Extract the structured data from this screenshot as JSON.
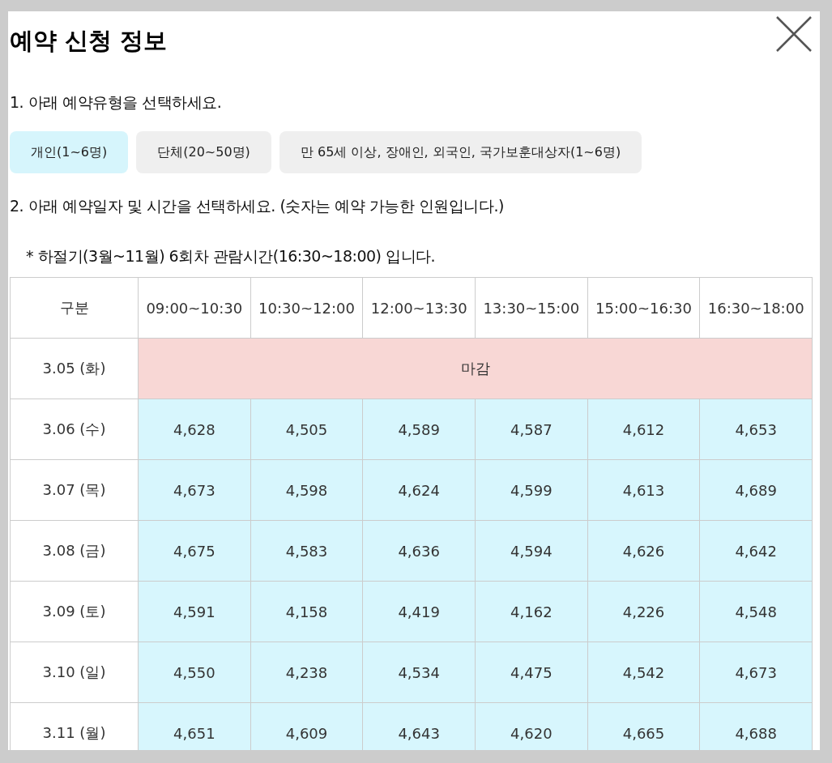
{
  "title": "예약 신청 정보",
  "step1": "1. 아래 예약유형을 선택하세요.",
  "types": [
    {
      "label": "개인(1~6명)",
      "selected": true
    },
    {
      "label": "단체(20~50명)",
      "selected": false
    },
    {
      "label": "만 65세 이상, 장애인, 외국인, 국가보훈대상자(1~6명)",
      "selected": false
    }
  ],
  "step2": "2. 아래 예약일자 및 시간을 선택하세요. (숫자는 예약 가능한 인원입니다.)",
  "note": "* 하절기(3월~11월) 6회차 관람시간(16:30~18:00) 입니다.",
  "table": {
    "columns": [
      "구분",
      "09:00~10:30",
      "10:30~12:00",
      "12:00~13:30",
      "13:30~15:00",
      "15:00~16:30",
      "16:30~18:00"
    ],
    "rows": [
      {
        "date": "3.05 (화)",
        "kind": "closed",
        "label": "마감"
      },
      {
        "date": "3.06 (수)",
        "kind": "open",
        "cells": [
          "4,628",
          "4,505",
          "4,589",
          "4,587",
          "4,612",
          "4,653"
        ]
      },
      {
        "date": "3.07 (목)",
        "kind": "open",
        "cells": [
          "4,673",
          "4,598",
          "4,624",
          "4,599",
          "4,613",
          "4,689"
        ]
      },
      {
        "date": "3.08 (금)",
        "kind": "open",
        "cells": [
          "4,675",
          "4,583",
          "4,636",
          "4,594",
          "4,626",
          "4,642"
        ]
      },
      {
        "date": "3.09 (토)",
        "kind": "open",
        "cells": [
          "4,591",
          "4,158",
          "4,419",
          "4,162",
          "4,226",
          "4,548"
        ]
      },
      {
        "date": "3.10 (일)",
        "kind": "open",
        "cells": [
          "4,550",
          "4,238",
          "4,534",
          "4,475",
          "4,542",
          "4,673"
        ]
      },
      {
        "date": "3.11 (월)",
        "kind": "open",
        "cells": [
          "4,651",
          "4,609",
          "4,643",
          "4,620",
          "4,665",
          "4,688"
        ]
      }
    ]
  }
}
